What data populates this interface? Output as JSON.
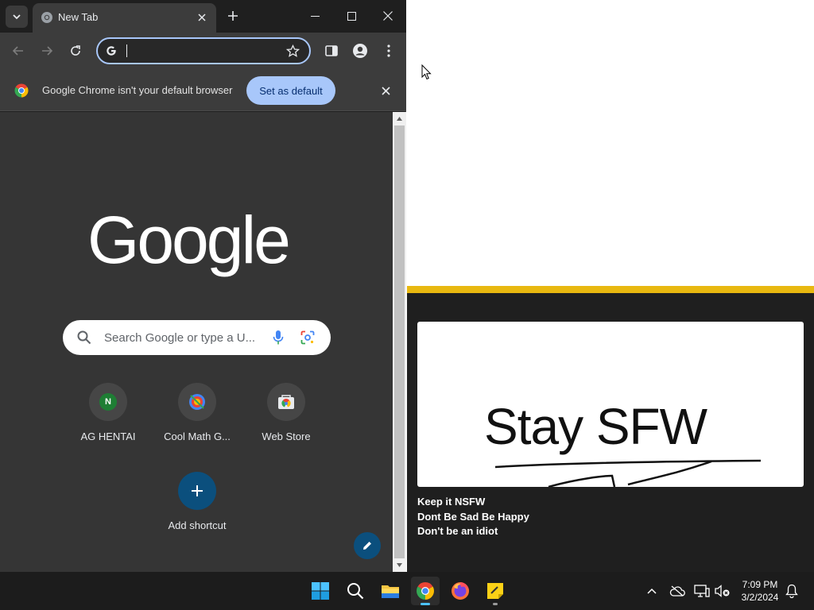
{
  "browser": {
    "tab_title": "New Tab",
    "omnibox_value": "",
    "infobar_message": "Google Chrome isn't your default browser",
    "set_default_label": "Set as default"
  },
  "newtab": {
    "logo_text": "Google",
    "search_placeholder": "Search Google or type a U...",
    "shortcuts": [
      {
        "label": "AG HENTAI",
        "icon": "letter-n-icon",
        "letter": "N"
      },
      {
        "label": "Cool Math G...",
        "icon": "coolmath-icon"
      },
      {
        "label": "Web Store",
        "icon": "webstore-icon"
      },
      {
        "label": "Add shortcut",
        "icon": "plus-icon"
      }
    ]
  },
  "sticky_note": {
    "image_text": "Stay SFW",
    "lines": [
      "Keep it NSFW",
      "Dont Be Sad Be Happy",
      "Don't be an idiot"
    ],
    "accent_color": "#e8b810"
  },
  "taskbar": {
    "apps": [
      "start-icon",
      "search-icon",
      "file-explorer-icon",
      "chrome-icon",
      "firefox-icon",
      "sticky-notes-icon"
    ],
    "time": "7:09 PM",
    "date": "3/2/2024"
  },
  "colors": {
    "omnibox_border": "#a8c7fa",
    "set_default_bg": "#a8c7fa",
    "taskbar_indicator": "#4cc2ff"
  }
}
